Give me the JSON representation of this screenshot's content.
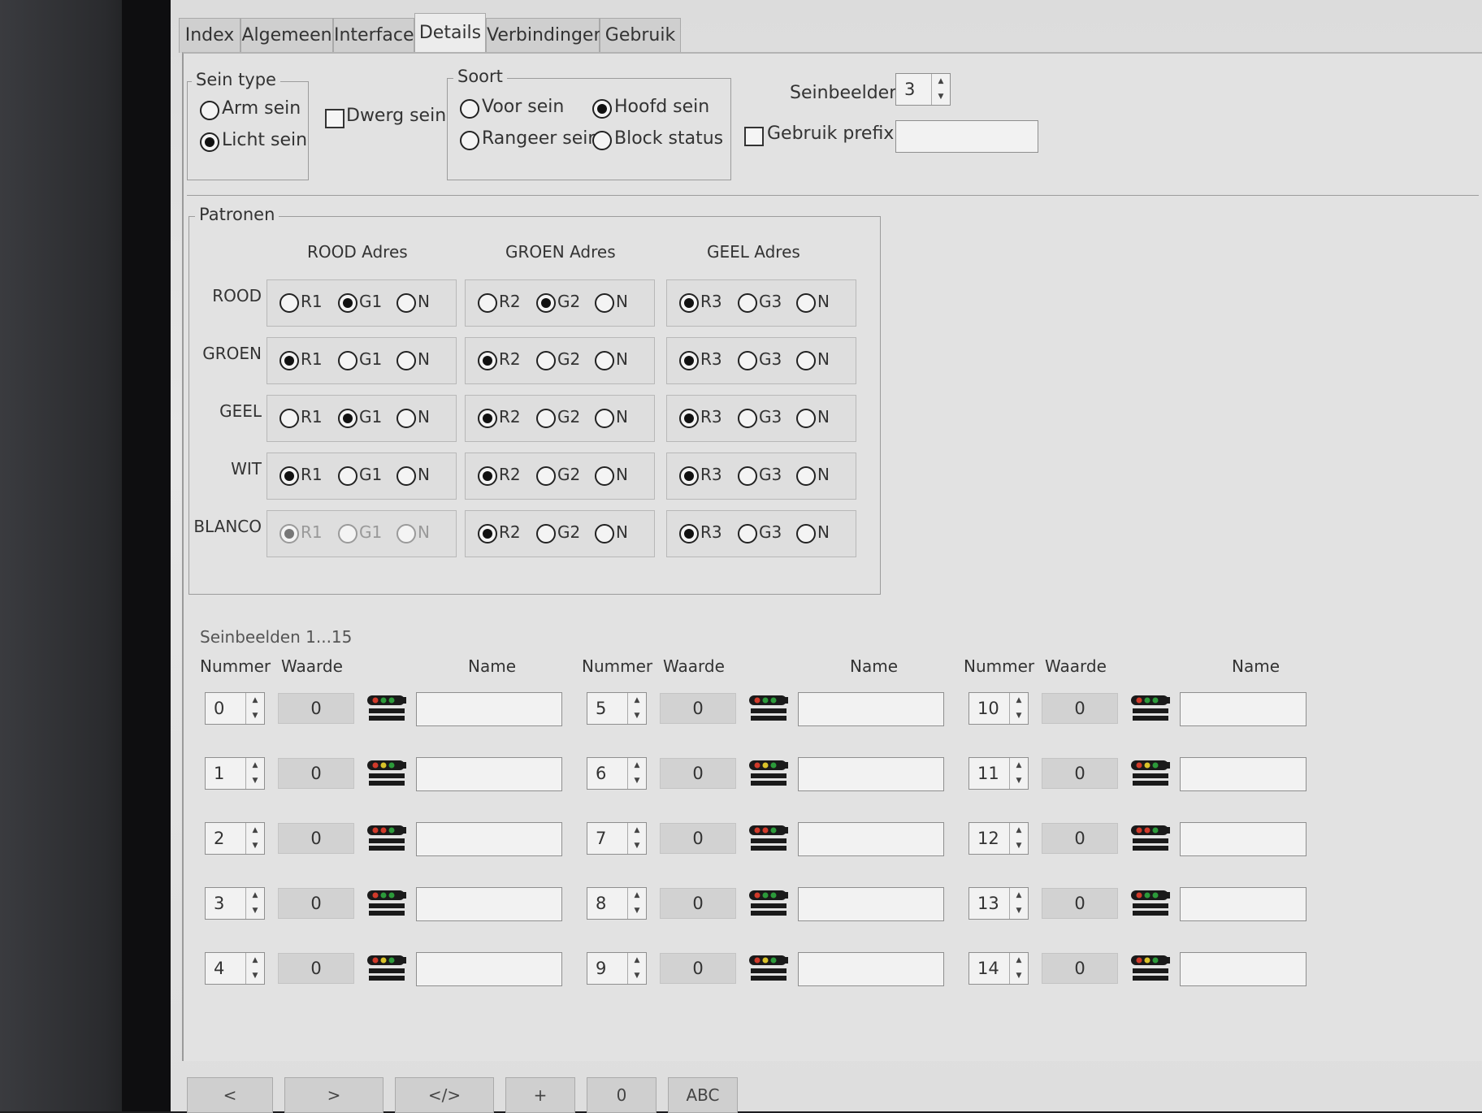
{
  "tabs": [
    "Index",
    "Algemeen",
    "Interface",
    "Details",
    "Verbindingen",
    "Gebruik"
  ],
  "sein_type": {
    "legend": "Sein type",
    "arm": "Arm sein",
    "licht": "Licht sein",
    "dwerg": "Dwerg sein"
  },
  "soort": {
    "legend": "Soort",
    "voor": "Voor sein",
    "hoofd": "Hoofd sein",
    "rangeer": "Rangeer sein",
    "block": "Block status"
  },
  "seinbeelden": {
    "label": "Seinbeelden",
    "value": "3",
    "prefix_label": "Gebruik prefix",
    "prefix_value": ""
  },
  "patronen": {
    "legend": "Patronen",
    "col_headers": [
      "ROOD Adres",
      "GROEN Adres",
      "GEEL Adres"
    ],
    "rows": [
      "ROOD",
      "GROEN",
      "GEEL",
      "WIT",
      "BLANCO"
    ],
    "options": [
      [
        "R1",
        "G1",
        "N"
      ],
      [
        "R2",
        "G2",
        "N"
      ],
      [
        "R3",
        "G3",
        "N"
      ]
    ],
    "selected": [
      [
        1,
        1,
        0
      ],
      [
        0,
        0,
        0
      ],
      [
        1,
        0,
        0
      ],
      [
        0,
        0,
        0
      ],
      [
        0,
        0,
        0
      ]
    ]
  },
  "list": {
    "section": "Seinbeelden 1...15",
    "headers": {
      "nummer": "Nummer",
      "waarde": "Waarde",
      "name": "Name"
    },
    "rows": [
      {
        "n": "0",
        "w": "0"
      },
      {
        "n": "1",
        "w": "0"
      },
      {
        "n": "2",
        "w": "0"
      },
      {
        "n": "3",
        "w": "0"
      },
      {
        "n": "4",
        "w": "0"
      },
      {
        "n": "5",
        "w": "0"
      },
      {
        "n": "6",
        "w": "0"
      },
      {
        "n": "7",
        "w": "0"
      },
      {
        "n": "8",
        "w": "0"
      },
      {
        "n": "9",
        "w": "0"
      },
      {
        "n": "10",
        "w": "0"
      },
      {
        "n": "11",
        "w": "0"
      },
      {
        "n": "12",
        "w": "0"
      },
      {
        "n": "13",
        "w": "0"
      },
      {
        "n": "14",
        "w": "0"
      }
    ]
  },
  "bottom_buttons": [
    "<",
    ">",
    "</>",
    "+",
    "0",
    "ABC"
  ],
  "colors": {
    "red": "#d03a2a",
    "green": "#2c9a3a",
    "yellow": "#d9c22a"
  }
}
